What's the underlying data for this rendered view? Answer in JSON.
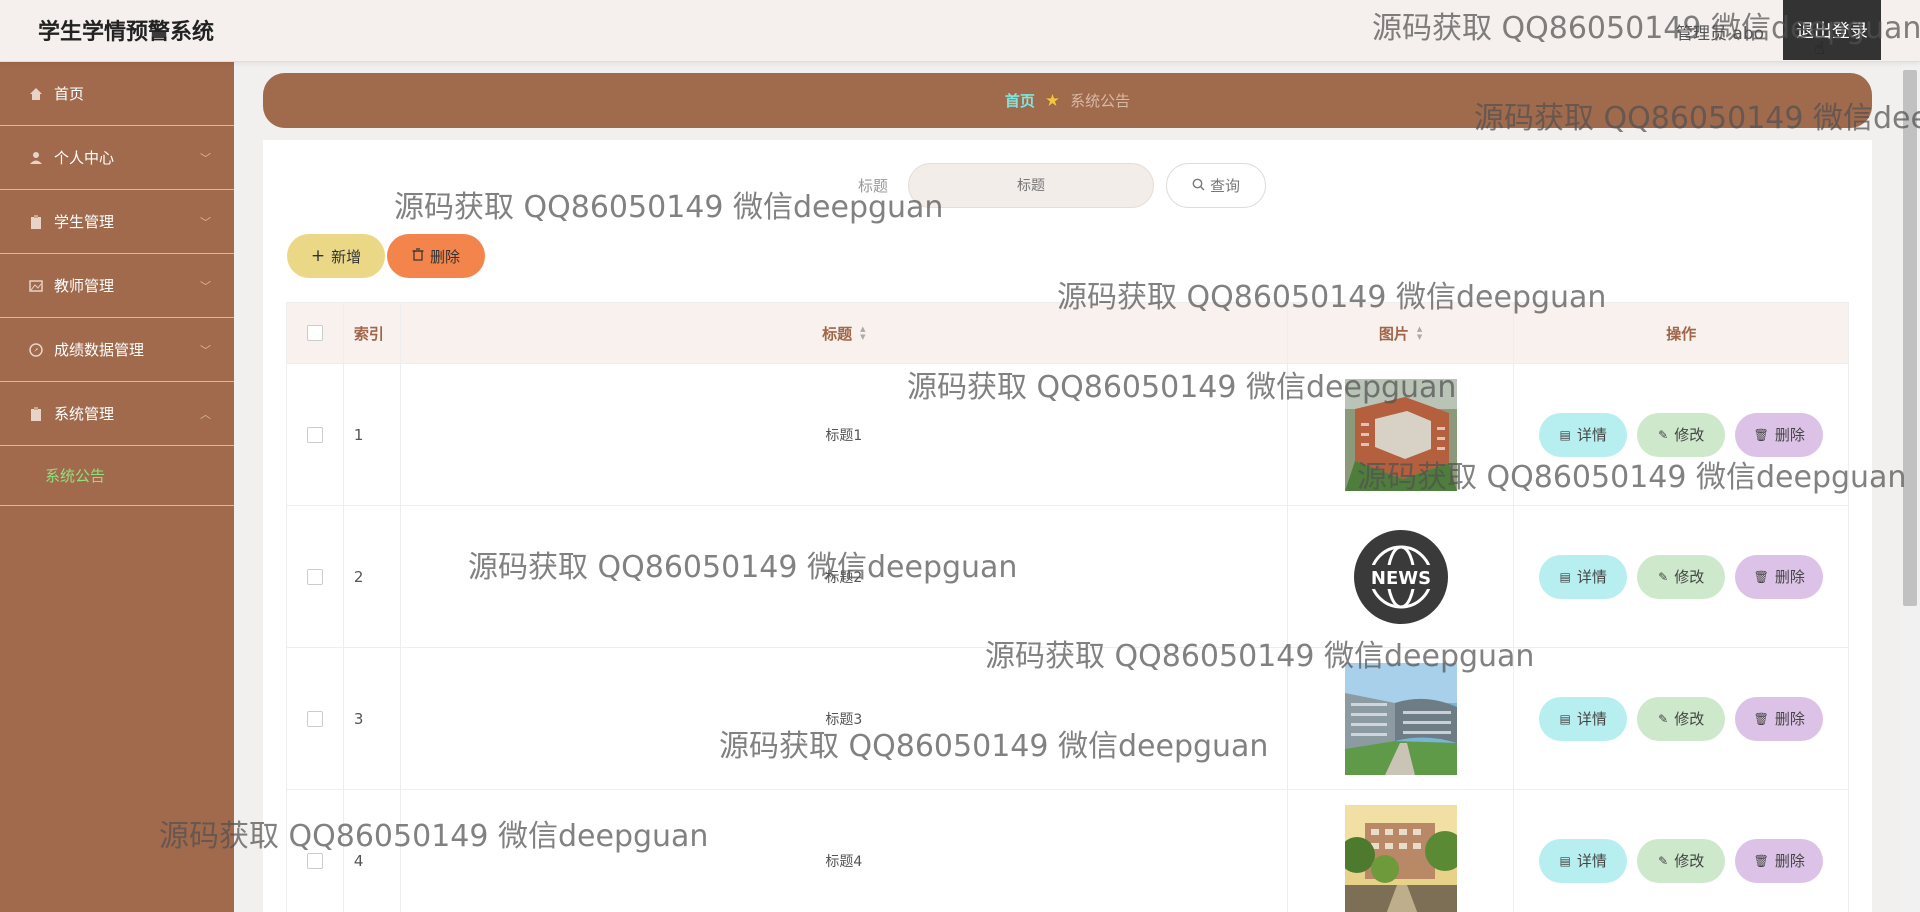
{
  "header": {
    "app_title": "学生学情预警系统",
    "admin_name": "管理员 abo",
    "logout_label": "退出登录"
  },
  "sidebar": {
    "items": [
      {
        "label": "首页",
        "icon": "home-icon"
      },
      {
        "label": "个人中心",
        "icon": "user-icon"
      },
      {
        "label": "学生管理",
        "icon": "clipboard-icon"
      },
      {
        "label": "教师管理",
        "icon": "image-icon"
      },
      {
        "label": "成绩数据管理",
        "icon": "compass-icon"
      },
      {
        "label": "系统管理",
        "icon": "clipboard-icon"
      }
    ],
    "submenu_label": "系统公告"
  },
  "breadcrumb": {
    "home": "首页",
    "current": "系统公告"
  },
  "search": {
    "label": "标题",
    "placeholder": "标题",
    "button_label": "查询"
  },
  "actions": {
    "add_label": "新增",
    "delete_label": "删除"
  },
  "table": {
    "headers": {
      "index": "索引",
      "title": "标题",
      "image": "图片",
      "ops": "操作"
    },
    "rows": [
      {
        "index": "1",
        "title": "标题1",
        "image": "building-photo"
      },
      {
        "index": "2",
        "title": "标题2",
        "image": "news-badge"
      },
      {
        "index": "3",
        "title": "标题3",
        "image": "campus-photo"
      },
      {
        "index": "4",
        "title": "标题4",
        "image": "trees-photo"
      }
    ],
    "op_labels": {
      "detail": "详情",
      "edit": "修改",
      "delete": "删除"
    },
    "news_badge_text": "NEWS"
  },
  "watermark": "源码获取 QQ86050149 微信deepguan",
  "colors": {
    "sidebar": "#a16a4d",
    "breadcrumb": "#a06a4d",
    "add_button": "#ebd886",
    "delete_button": "#f2844c",
    "detail_button": "#b7eef0",
    "edit_button": "#cde8cb",
    "row_delete_button": "#dcc2e6",
    "active_submenu": "#8fe07a",
    "breadcrumb_home": "#7fe6dd"
  }
}
